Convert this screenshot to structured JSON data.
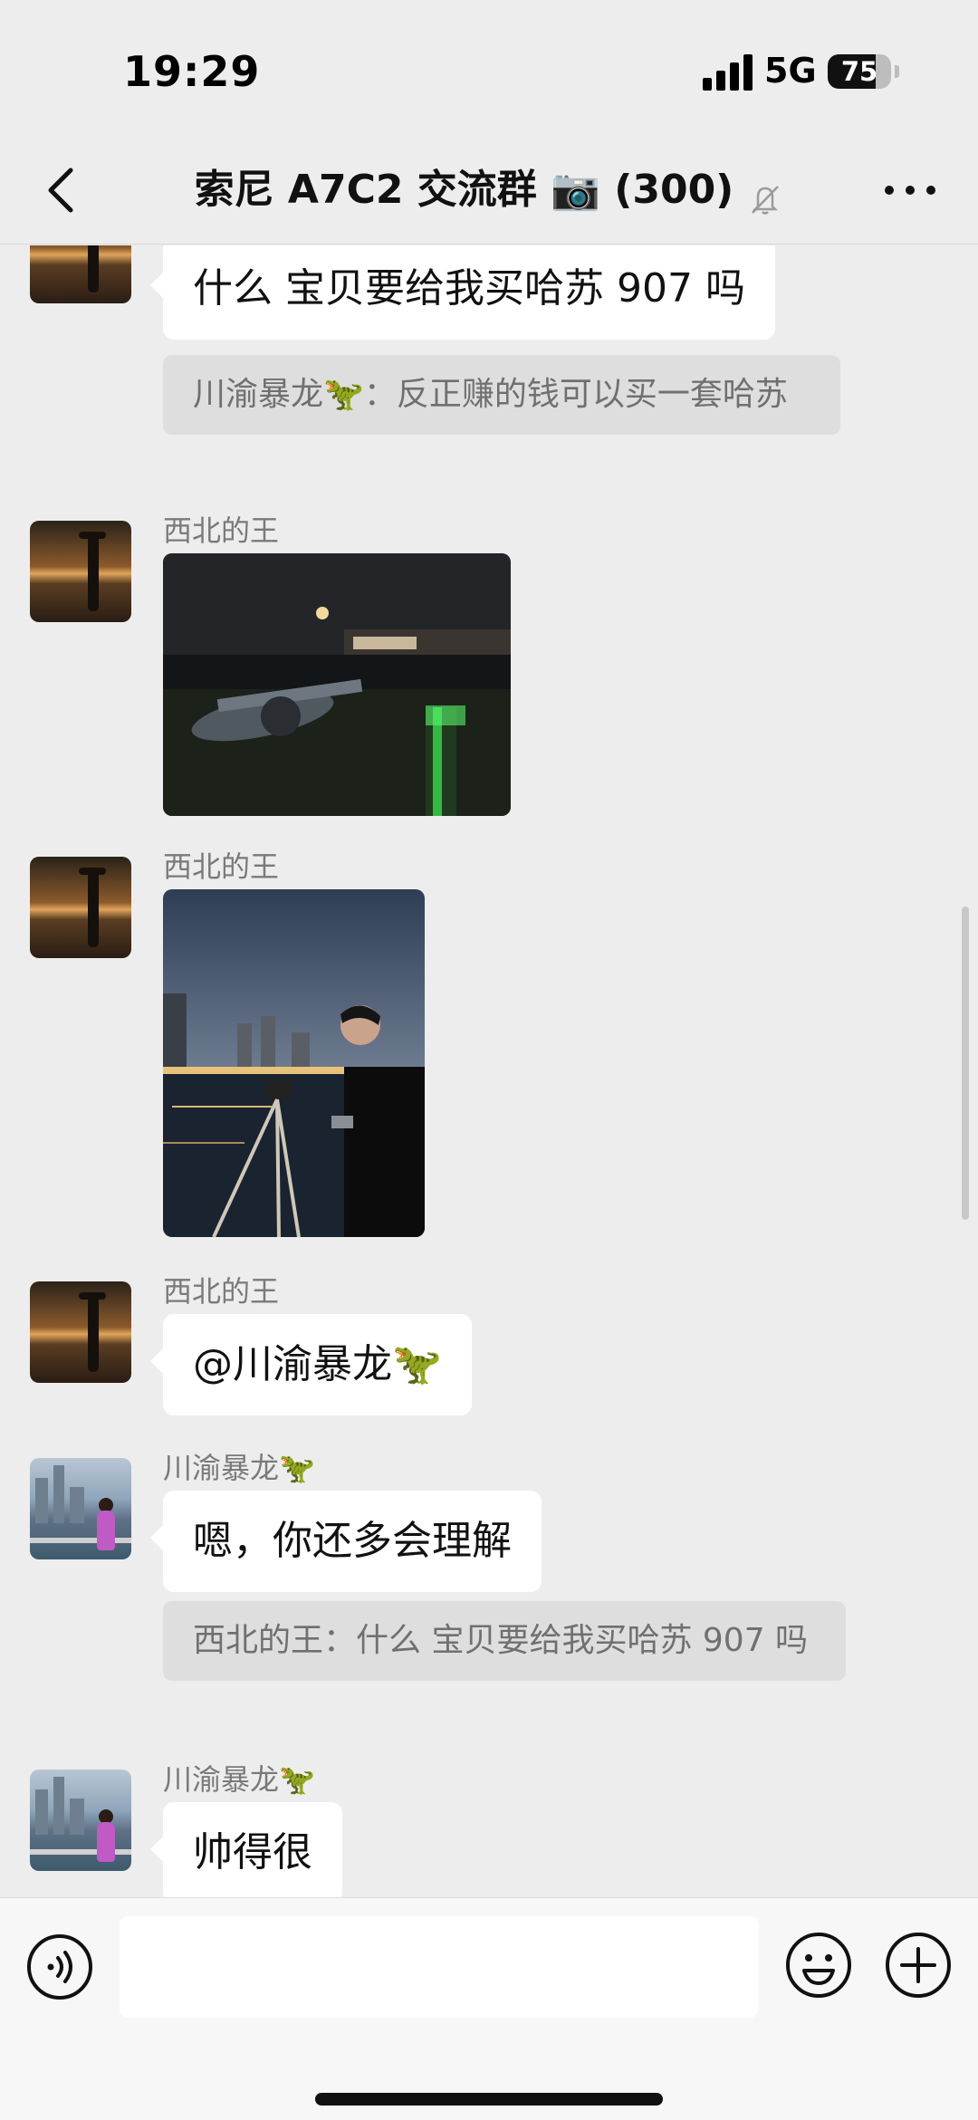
{
  "status": {
    "time": "19:29",
    "network": "5G",
    "battery": "75",
    "battery_level": 0.75
  },
  "header": {
    "title": "索尼 A7C2 交流群 📷 (300)"
  },
  "messages": {
    "m1": {
      "text": "什么  宝贝要给我买哈苏 907 吗",
      "quote": "川渝暴龙🦖：反正赚的钱可以买一套哈苏"
    },
    "m2": {
      "sender": "西北的王"
    },
    "m3": {
      "sender": "西北的王"
    },
    "m4": {
      "sender": "西北的王",
      "text": "@川渝暴龙🦖"
    },
    "m5": {
      "sender": "川渝暴龙🦖",
      "text": "嗯，你还多会理解",
      "quote": "西北的王：什么  宝贝要给我买哈苏 907 吗"
    },
    "m6": {
      "sender": "川渝暴龙🦖",
      "text": "帅得很"
    }
  },
  "icons": {
    "back": "chevron-left-icon",
    "mute": "bell-slash-icon",
    "more": "more-dots-icon",
    "voice": "voice-icon",
    "emoji": "emoji-icon",
    "plus": "plus-circle-icon"
  },
  "colors": {
    "background": "#ededed",
    "bubble": "#ffffff",
    "quote": "#dedede"
  }
}
